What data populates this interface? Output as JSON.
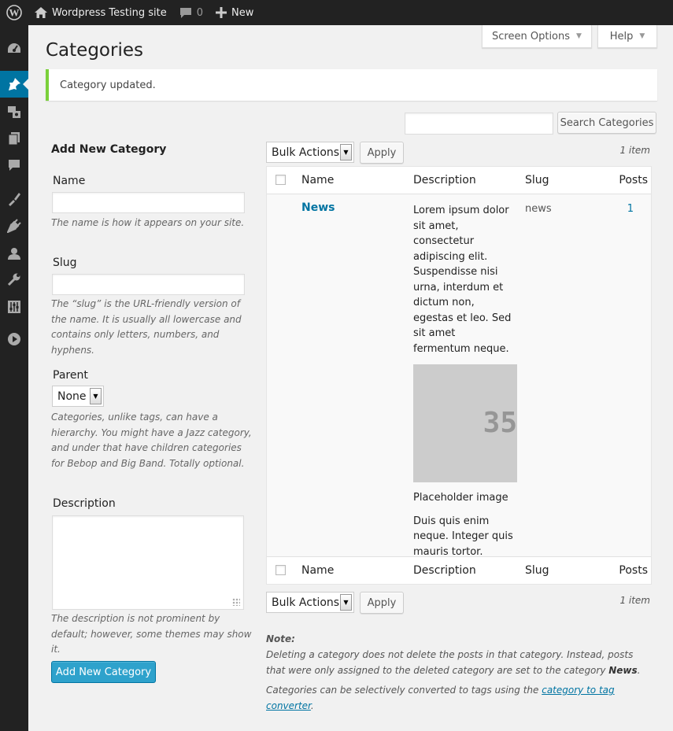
{
  "admin_bar": {
    "site_name": "Wordpress Testing site",
    "comments_count": "0",
    "new_label": "New"
  },
  "sidebar": {
    "icons": [
      "dashboard-icon",
      "pin-icon",
      "media-icon",
      "pages-icon",
      "comments-icon",
      "appearance-icon",
      "plugins-icon",
      "users-icon",
      "tools-icon",
      "settings-icon",
      "play-icon"
    ],
    "active_index": 1,
    "accent_color": "#0074a2"
  },
  "header": {
    "title": "Categories",
    "screen_options_label": "Screen Options",
    "help_label": "Help"
  },
  "notice": {
    "text": "Category updated.",
    "color": "#7ad03a"
  },
  "search": {
    "value": "",
    "button_label": "Search Categories"
  },
  "form": {
    "heading": "Add New Category",
    "name_label": "Name",
    "name_value": "",
    "name_hint": "The name is how it appears on your site.",
    "slug_label": "Slug",
    "slug_value": "",
    "slug_hint": "The “slug” is the URL-friendly version of the name. It is usually all lowercase and contains only letters, numbers, and hyphens.",
    "parent_label": "Parent",
    "parent_value": "None",
    "parent_hint": "Categories, unlike tags, can have a hierarchy. You might have a Jazz category, and under that have children categories for Bebop and Big Band. Totally optional.",
    "description_label": "Description",
    "description_value": "",
    "description_hint": "The description is not prominent by default; however, some themes may show it.",
    "submit_label": "Add New Category",
    "submit_color": "#2ea2cc"
  },
  "table": {
    "bulk_actions": "Bulk Actions",
    "apply_label": "Apply",
    "items_count": "1 item",
    "columns": [
      "Name",
      "Description",
      "Slug",
      "Posts"
    ],
    "rows": [
      {
        "name": "News",
        "description_intro": "Lorem ipsum dolor sit amet, consectetur adipiscing elit. Suspendisse nisi urna, interdum et dictum non, egestas et leo. Sed sit amet fermentum neque.",
        "image_text": "35",
        "image_caption": "Placeholder image",
        "description_outro": "Duis quis enim neque. Integer quis mauris tortor.",
        "slug": "news",
        "posts": "1"
      }
    ]
  },
  "notes": {
    "title": "Note:",
    "line1_pre": "Deleting a category does not delete the posts in that category. Instead, posts that were only assigned to the deleted category are set to the category ",
    "line1_bold": "News",
    "line1_post": ".",
    "line2_pre": "Categories can be selectively converted to tags using the ",
    "line2_link": "category to tag converter",
    "line2_post": "."
  }
}
